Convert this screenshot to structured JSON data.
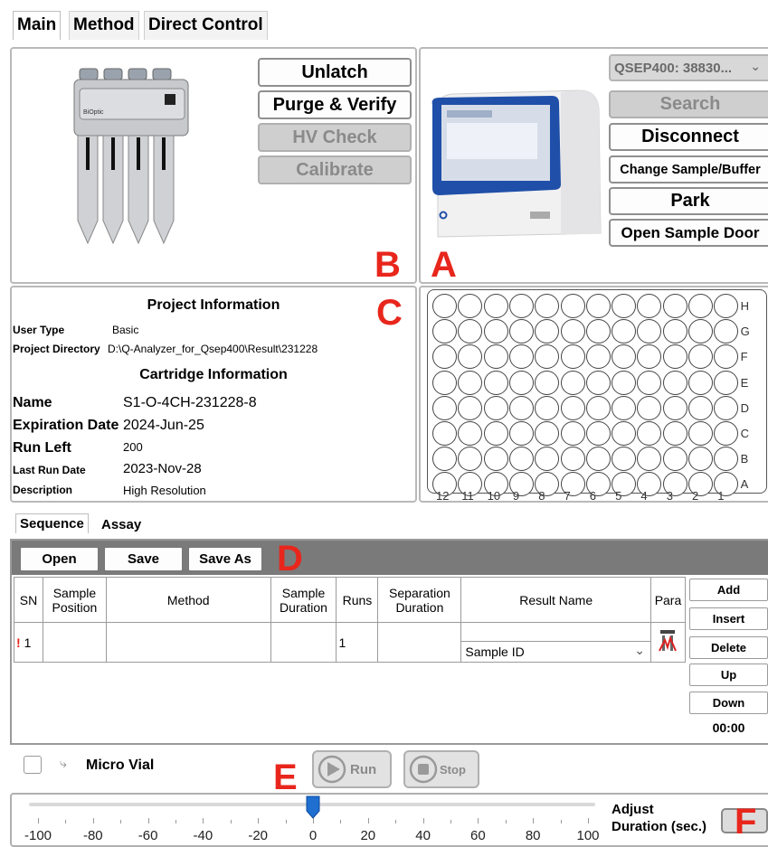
{
  "tabs": [
    "Main",
    "Method",
    "Direct Control"
  ],
  "cartridge_panel": {
    "buttons": {
      "unlatch": "Unlatch",
      "purge_verify": "Purge & Verify",
      "hv_check": "HV Check",
      "calibrate": "Calibrate"
    },
    "cartridge_brand": "BiOptic"
  },
  "instrument_panel": {
    "device_select": "QSEP400: 38830...",
    "buttons": {
      "search": "Search",
      "disconnect": "Disconnect",
      "change_sample_buffer": "Change Sample/Buffer",
      "park": "Park",
      "open_sample_door": "Open Sample Door"
    }
  },
  "annotation_letters": {
    "a": "A",
    "b": "B",
    "c": "C",
    "d": "D",
    "e": "E",
    "f": "F"
  },
  "project_info": {
    "title": "Project Information",
    "user_type_label": "User Type",
    "user_type_value": "Basic",
    "project_dir_label": "Project Directory",
    "project_dir_value": "D:\\Q-Analyzer_for_Qsep400\\Result\\231228"
  },
  "cartridge_info": {
    "title": "Cartridge Information",
    "name_label": "Name",
    "name_value": "S1-O-4CH-231228-8",
    "expiration_label": "Expiration Date",
    "expiration_value": "2024-Jun-25",
    "run_left_label": "Run Left",
    "run_left_value": "200",
    "last_run_label": "Last Run Date",
    "last_run_value": "2023-Nov-28",
    "description_label": "Description",
    "description_value": "High Resolution"
  },
  "plate": {
    "rows": [
      "H",
      "G",
      "F",
      "E",
      "D",
      "C",
      "B",
      "A"
    ],
    "cols": [
      "12",
      "11",
      "10",
      "9",
      "8",
      "7",
      "6",
      "5",
      "4",
      "3",
      "2",
      "1"
    ]
  },
  "sequence_tabs": [
    "Sequence",
    "Assay"
  ],
  "toolbar": {
    "open": "Open",
    "save": "Save",
    "save_as": "Save As"
  },
  "table": {
    "headers": {
      "sn": "SN",
      "sample_position": "Sample Position",
      "method": "Method",
      "sample_duration": "Sample Duration",
      "runs": "Runs",
      "separation_duration": "Separation Duration",
      "result_name": "Result Name",
      "para": "Para"
    },
    "row1": {
      "warning": "!",
      "sn": "1",
      "runs": "1",
      "result_name_select": "Sample ID"
    }
  },
  "side_buttons": {
    "add": "Add",
    "insert": "Insert",
    "delete": "Delete",
    "up": "Up",
    "down": "Down"
  },
  "timer": "00:00",
  "micro_vial_label": "Micro Vial",
  "run_button": "Run",
  "stop_button": "Stop",
  "slider": {
    "tick_labels": [
      "-100",
      "-80",
      "-60",
      "-40",
      "-20",
      "0",
      "20",
      "40",
      "60",
      "80",
      "100"
    ],
    "value": 0,
    "label_line1": "Adjust",
    "label_line2": "Duration (sec.)"
  },
  "colors": {
    "accent_red": "#e8261c",
    "slider_thumb": "#1f6fd1",
    "toolbar_gray": "#7a7a7a"
  }
}
